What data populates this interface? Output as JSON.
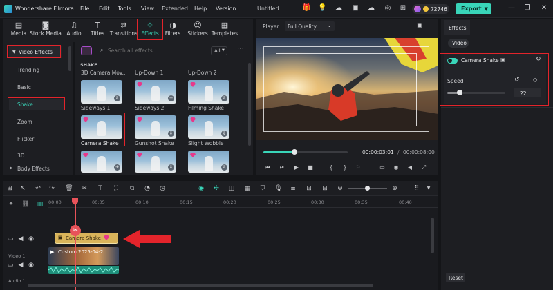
{
  "app": {
    "name": "Wondershare Filmora",
    "project_title": "Untitled",
    "menu": [
      "File",
      "Edit",
      "Tools",
      "View",
      "Extended",
      "Help",
      "Version"
    ],
    "credits": "72746",
    "export_label": "Export"
  },
  "toolbar": {
    "tabs": [
      {
        "label": "Media",
        "icon": "media-icon"
      },
      {
        "label": "Stock Media",
        "icon": "stock-media-icon"
      },
      {
        "label": "Audio",
        "icon": "music-note-icon"
      },
      {
        "label": "Titles",
        "icon": "titles-icon"
      },
      {
        "label": "Transitions",
        "icon": "transitions-icon"
      },
      {
        "label": "Effects",
        "icon": "effects-icon",
        "active": true
      },
      {
        "label": "Filters",
        "icon": "filters-icon"
      },
      {
        "label": "Stickers",
        "icon": "stickers-icon"
      },
      {
        "label": "Templates",
        "icon": "templates-icon"
      }
    ]
  },
  "sidebar": {
    "header": "Video Effects",
    "items": [
      "Trending",
      "Basic",
      "Shake",
      "Zoom",
      "Flicker",
      "3D"
    ],
    "selected": "Shake",
    "footer": "Body Effects"
  },
  "effects": {
    "search_placeholder": "Search all effects",
    "filter_label": "All",
    "section_label": "SHAKE",
    "partial_row": [
      "3D Camera Mov...",
      "Up-Down 1",
      "Up-Down 2"
    ],
    "rows": [
      [
        "Sideways 1",
        "Sideways 2",
        "Filming Shake"
      ],
      [
        "Camera Shake",
        "Gunshot Shake",
        "Slight Wobble"
      ]
    ]
  },
  "player": {
    "label": "Player",
    "quality": "Full Quality",
    "current_time": "00:00:03:01",
    "total_time": "00:00:08:00",
    "progress": 0.37
  },
  "right_panel": {
    "tab": "Effects",
    "subtab": "Video",
    "effect_name": "Camera Shake",
    "speed_label": "Speed",
    "speed_value": "22",
    "speed_fraction": 0.22,
    "reset_label": "Reset"
  },
  "timeline": {
    "ruler": [
      "00:00",
      "00:05",
      "00:10",
      "00:15",
      "00:20",
      "00:25",
      "00:30",
      "00:35",
      "00:40"
    ],
    "effect_clip_label": "Camera Shake",
    "video_clip_label": "Custom 2025-04-2...",
    "video_track_label": "Video 1",
    "audio_track_label": "Audio 1"
  },
  "colors": {
    "accent": "#39d5b9",
    "highlight_red": "#e3242b",
    "playhead": "#e8535a",
    "effect_clip": "#d9b45a"
  }
}
